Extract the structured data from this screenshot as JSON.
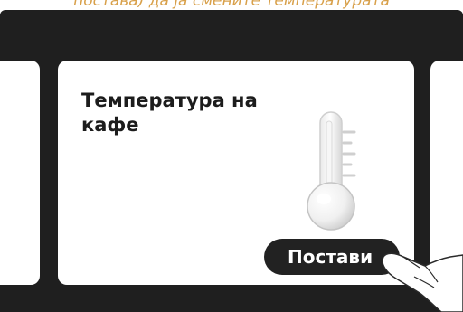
{
  "caption": "поставa) да ја смените температурата",
  "card": {
    "title": "Температура на кафе",
    "button_label": "Постави"
  },
  "icons": {
    "thermometer": "thermometer-icon",
    "hand": "pointing-hand-icon"
  },
  "colors": {
    "caption": "#d8a04a",
    "screen": "#1f1f1f",
    "button": "#222222",
    "card": "#ffffff"
  }
}
